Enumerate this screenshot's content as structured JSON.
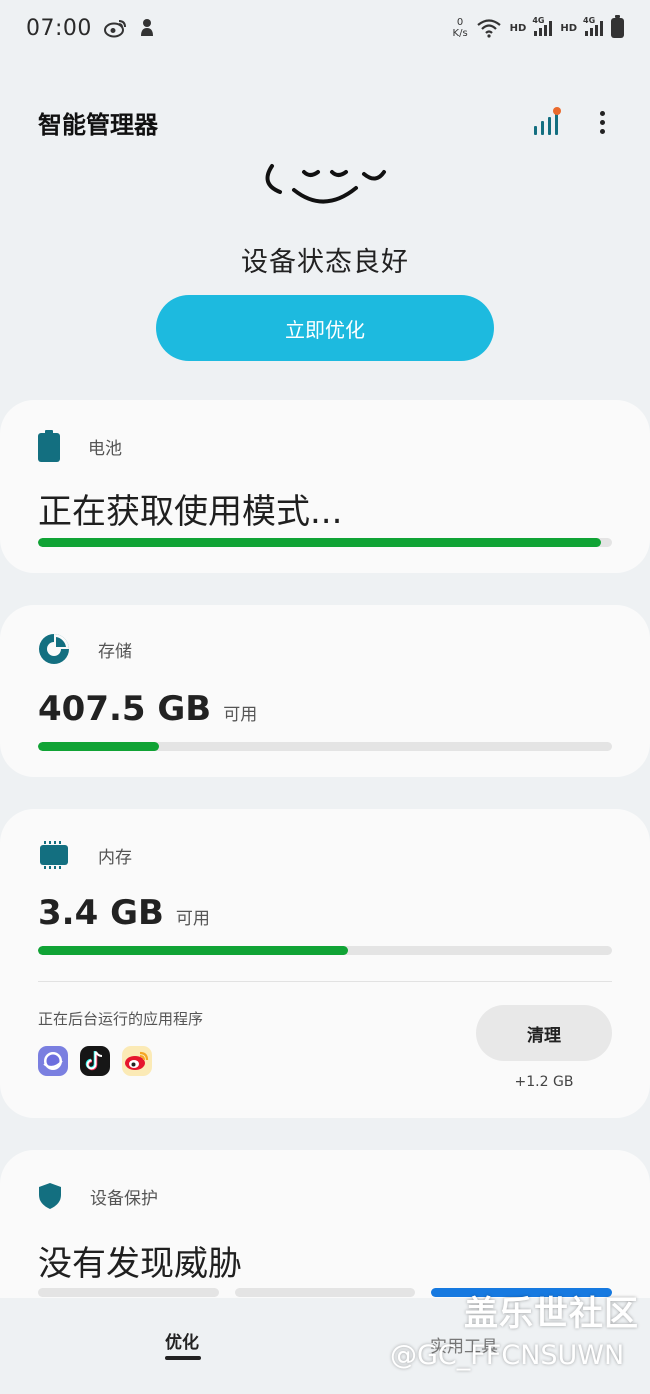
{
  "status_bar": {
    "time": "07:00",
    "net_speed_value": "0",
    "net_speed_unit": "K/s",
    "hd1": "HD",
    "net1": "4G",
    "hd2": "HD",
    "net2": "4G"
  },
  "app_bar": {
    "title": "智能管理器"
  },
  "hero": {
    "status": "设备状态良好",
    "optimize_label": "立即优化"
  },
  "battery_card": {
    "label": "电池",
    "status": "正在获取使用模式...",
    "progress_fraction": 0.98
  },
  "storage_card": {
    "label": "存储",
    "value": "407.5 GB",
    "unit": "可用",
    "progress_fraction": 0.21
  },
  "memory_card": {
    "label": "内存",
    "value": "3.4 GB",
    "unit": "可用",
    "progress_fraction": 0.54,
    "bg_apps_label": "正在后台运行的应用程序",
    "bg_apps": [
      "samsung-internet-icon",
      "tiktok-icon",
      "weibo-icon"
    ],
    "clean_label": "清理",
    "freed": "+1.2 GB"
  },
  "protection_card": {
    "label": "设备保护",
    "status": "没有发现威胁"
  },
  "bottom_nav": {
    "tab_optimize": "优化",
    "tab_tools": "实用工具"
  },
  "watermark": {
    "title": "盖乐世社区",
    "user": "@GC_FFCNSUWN"
  },
  "colors": {
    "accent": "#1dbadf",
    "progress_green": "#10a335",
    "icon_teal": "#136f80",
    "protection_blue": "#1679e0"
  }
}
